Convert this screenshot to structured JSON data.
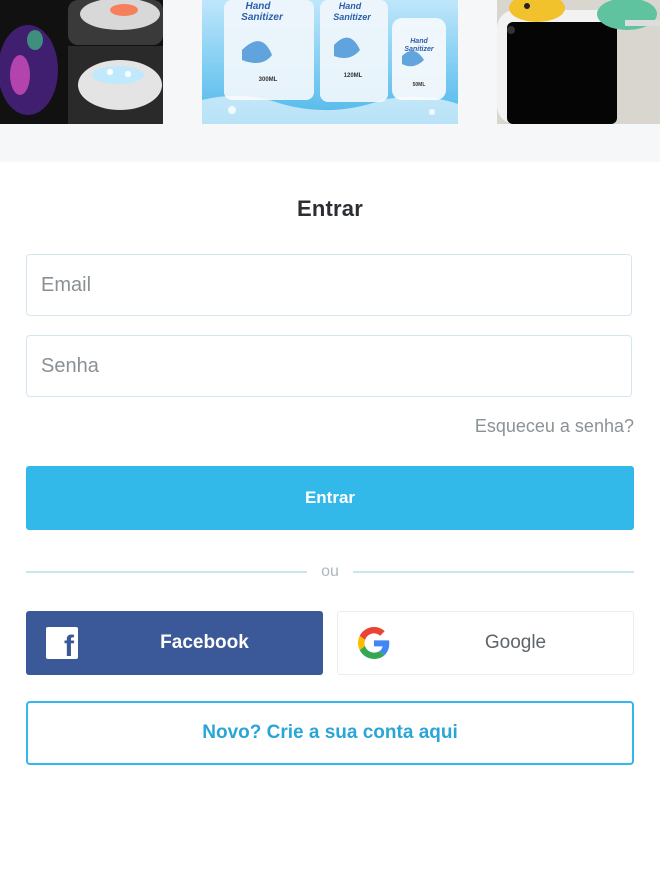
{
  "banner": {
    "images": [
      {
        "name": "light-up-shoelaces-image"
      },
      {
        "name": "hand-sanitizer-image"
      },
      {
        "name": "phone-cable-bite-image"
      }
    ],
    "sanitizer_labels": [
      "Hand Sanitizer",
      "Hand Sanitizer",
      "Hand Sanitizer"
    ],
    "sanitizer_sizes": [
      "300ML",
      "120ML",
      "50ML"
    ]
  },
  "login": {
    "title": "Entrar",
    "email_placeholder": "Email",
    "password_placeholder": "Senha",
    "forgot_password": "Esqueceu a senha?",
    "submit_label": "Entrar",
    "divider_text": "ou",
    "facebook_label": "Facebook",
    "google_label": "Google",
    "register_label": "Novo? Crie a sua conta aqui"
  },
  "colors": {
    "accent": "#33b8ea",
    "facebook": "#3b5998"
  },
  "icons": {
    "facebook": "facebook-icon",
    "google": "google-icon"
  }
}
